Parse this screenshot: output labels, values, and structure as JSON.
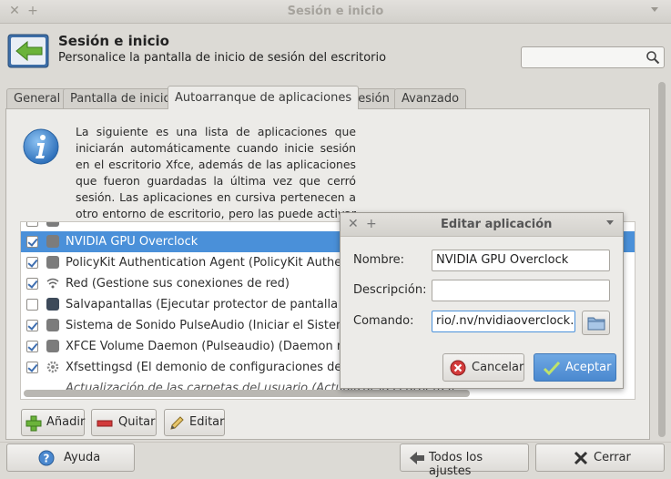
{
  "window": {
    "title": "Sesión e inicio"
  },
  "header": {
    "title": "Sesión e inicio",
    "subtitle": "Personalice la pantalla de inicio de sesión del escritorio",
    "search_value": ""
  },
  "tabs": [
    {
      "label": "General",
      "active": false
    },
    {
      "label": "Pantalla de inicio",
      "active": false
    },
    {
      "label": "Autoarranque de aplicaciones",
      "active": true
    },
    {
      "label": "Sesión",
      "active": false
    },
    {
      "label": "Avanzado",
      "active": false
    }
  ],
  "info": {
    "text": "La siguiente es una lista de aplicaciones que iniciarán automáticamente cuando inicie sesión en el escritorio Xfce, además de las aplicaciones que fueron guardadas la última vez que cerró sesión. Las aplicaciones en cursiva pertenecen a otro entorno de escritorio, pero las puede activar si así lo desea."
  },
  "apps": [
    {
      "label": "NVIDIA GPU Overclock",
      "checked": true,
      "selected": true,
      "icon": "gear-icon"
    },
    {
      "label": "PolicyKit Authentication Agent (PolicyKit Authentication Agent)",
      "checked": true,
      "selected": false,
      "icon": "gear-icon"
    },
    {
      "label": "Red (Gestione sus conexiones de red)",
      "checked": true,
      "selected": false,
      "icon": "wifi-icon"
    },
    {
      "label": "Salvapantallas (Ejecutar protector de pantalla y el programa de bloqueo)",
      "checked": false,
      "selected": false,
      "icon": "monitor-icon"
    },
    {
      "label": "Sistema de Sonido PulseAudio (Iniciar el Sistema de Sonido PulseAudio)",
      "checked": true,
      "selected": false,
      "icon": "gear-icon"
    },
    {
      "label": "XFCE Volume Daemon (Pulseaudio) (Daemon manager)",
      "checked": true,
      "selected": false,
      "icon": "gear-icon"
    },
    {
      "label": "Xfsettingsd (El demonio de configuraciones de Xfce)",
      "checked": true,
      "selected": false,
      "icon": "settings-icon"
    },
    {
      "label": "Actualización de las carpetas del usuario (Actualizar las carpetas)",
      "checked": false,
      "selected": false,
      "icon": "none",
      "italic": true
    }
  ],
  "list_buttons": {
    "add": "Añadir",
    "remove": "Quitar",
    "edit": "Editar"
  },
  "dialog": {
    "title": "Editar aplicación",
    "name_label": "Nombre:",
    "name_value": "NVIDIA GPU Overclock",
    "desc_label": "Descripción:",
    "desc_value": "",
    "cmd_label": "Comando:",
    "cmd_value": "rio/.nv/nvidiaoverclock.sh",
    "cancel": "Cancelar",
    "accept": "Aceptar"
  },
  "footer": {
    "help": "Ayuda",
    "all_settings": "Todos los ajustes",
    "close": "Cerrar"
  },
  "colors": {
    "selection": "#4a90d9",
    "accent_button": "#4a88cf"
  }
}
